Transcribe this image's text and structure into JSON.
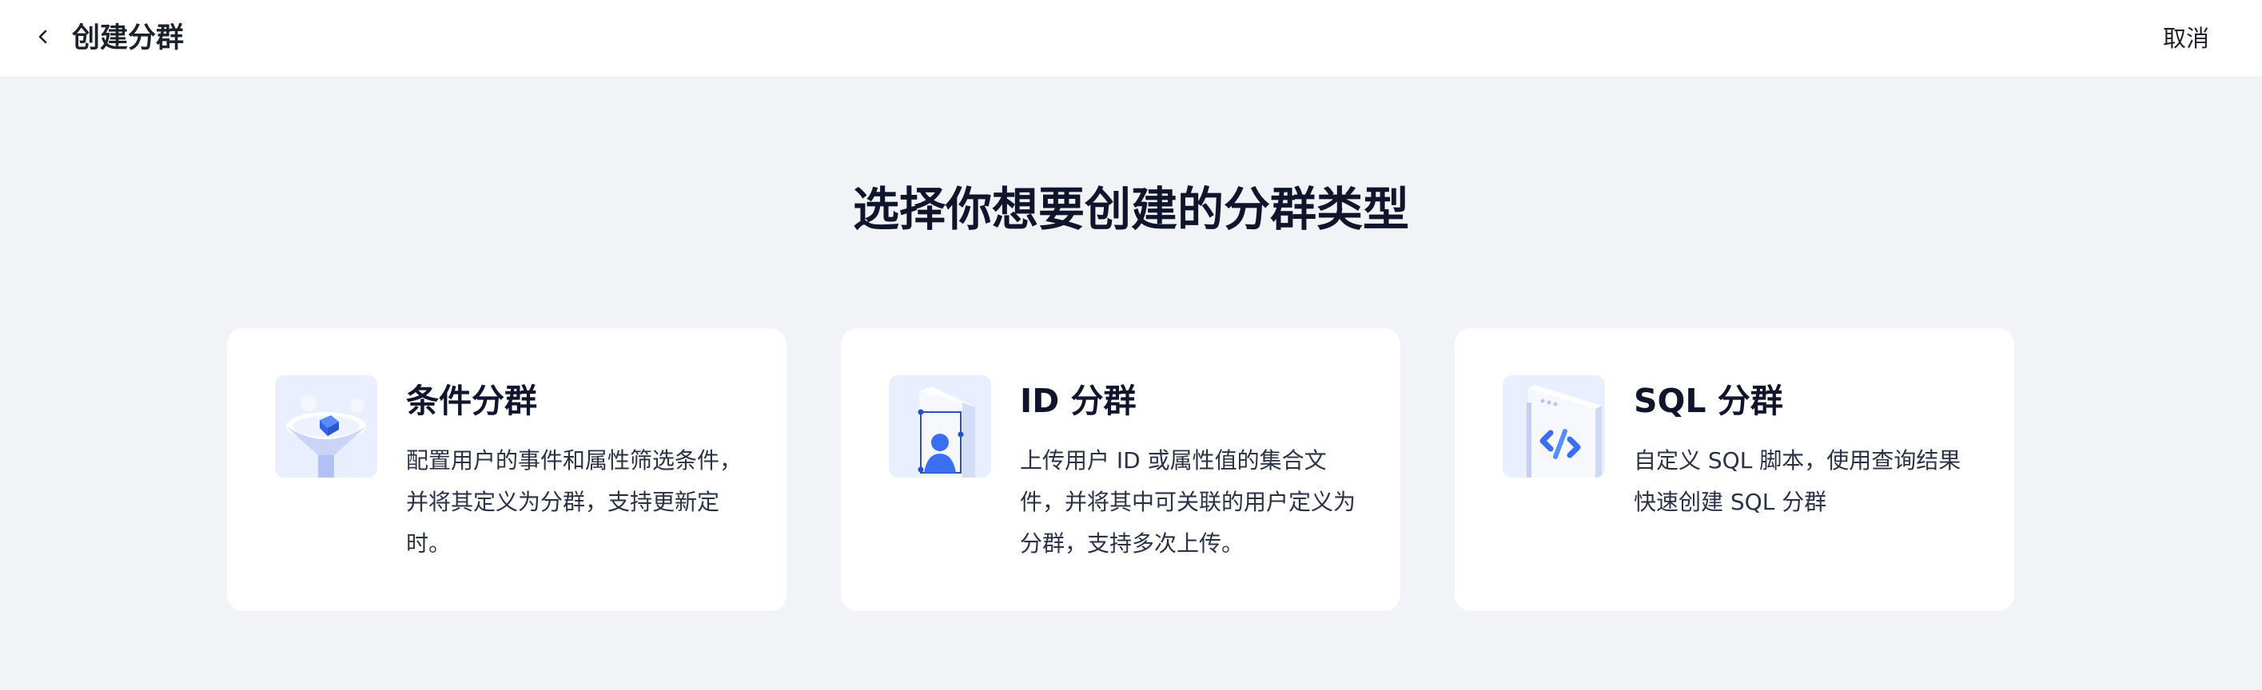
{
  "header": {
    "title": "创建分群",
    "cancel_label": "取消"
  },
  "main": {
    "headline": "选择你想要创建的分群类型",
    "cards": [
      {
        "title": "条件分群",
        "description": "配置用户的事件和属性筛选条件，并将其定义为分群，支持更新定时。",
        "icon": "funnel-icon"
      },
      {
        "title": "ID 分群",
        "description": "上传用户 ID 或属性值的集合文件，并将其中可关联的用户定义为分群，支持多次上传。",
        "icon": "user-id-card-icon"
      },
      {
        "title": "SQL 分群",
        "description": "自定义 SQL 脚本，使用查询结果快速创建 SQL 分群",
        "icon": "code-window-icon"
      }
    ]
  },
  "colors": {
    "page_background": "#f2f3f7",
    "card_background": "#ffffff",
    "icon_tile_background": "#e8efff",
    "accent_blue": "#3a6ff2",
    "text_primary": "#10152b"
  }
}
